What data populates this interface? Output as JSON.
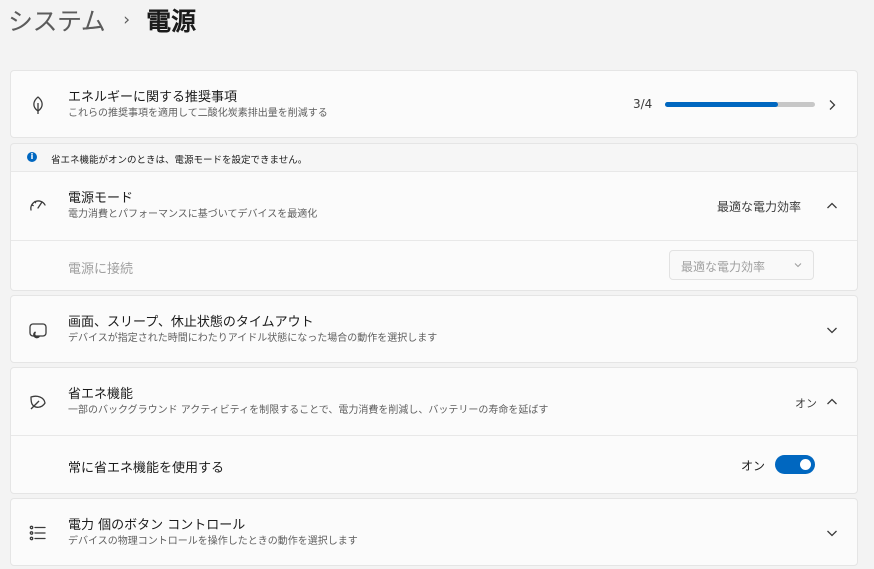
{
  "breadcrumb": {
    "parent": "システム",
    "separator": "›",
    "current": "電源"
  },
  "energy_rec": {
    "title": "エネルギーに関する推奨事項",
    "desc": "これらの推奨事項を適用して二酸化炭素排出量を削減する",
    "count": "3/4",
    "progress": 0.75,
    "icon": "leaf-icon"
  },
  "banner": {
    "text": "省エネ機能がオンのときは、電源モードを設定できません。",
    "icon": "info-icon"
  },
  "power_mode": {
    "title": "電源モード",
    "desc": "電力消費とパフォーマンスに基づいてデバイスを最適化",
    "value": "最適な電力効率",
    "icon": "gauge-icon",
    "plugged_in": {
      "label": "電源に接続",
      "selected": "最適な電力効率"
    }
  },
  "screen_sleep": {
    "title": "画面、スリープ、休止状態のタイムアウト",
    "desc": "デバイスが指定された時間にわたりアイドル状態になった場合の動作を選択します",
    "icon": "screen-sleep-icon"
  },
  "energy_saver": {
    "title": "省エネ機能",
    "desc": "一部のバックグラウンド アクティビティを制限することで、電力消費を削減し、バッテリーの寿命を延ばす",
    "status": "オン",
    "icon": "energy-saver-icon",
    "always_on": {
      "label": "常に省エネ機能を使用する",
      "state": "オン",
      "enabled": true
    }
  },
  "power_buttons": {
    "title": "電力 個のボタン コントロール",
    "desc": "デバイスの物理コントロールを操作したときの動作を選択します",
    "icon": "list-settings-icon"
  },
  "colors": {
    "accent": "#0067c0",
    "track": "#c7c7c7"
  }
}
